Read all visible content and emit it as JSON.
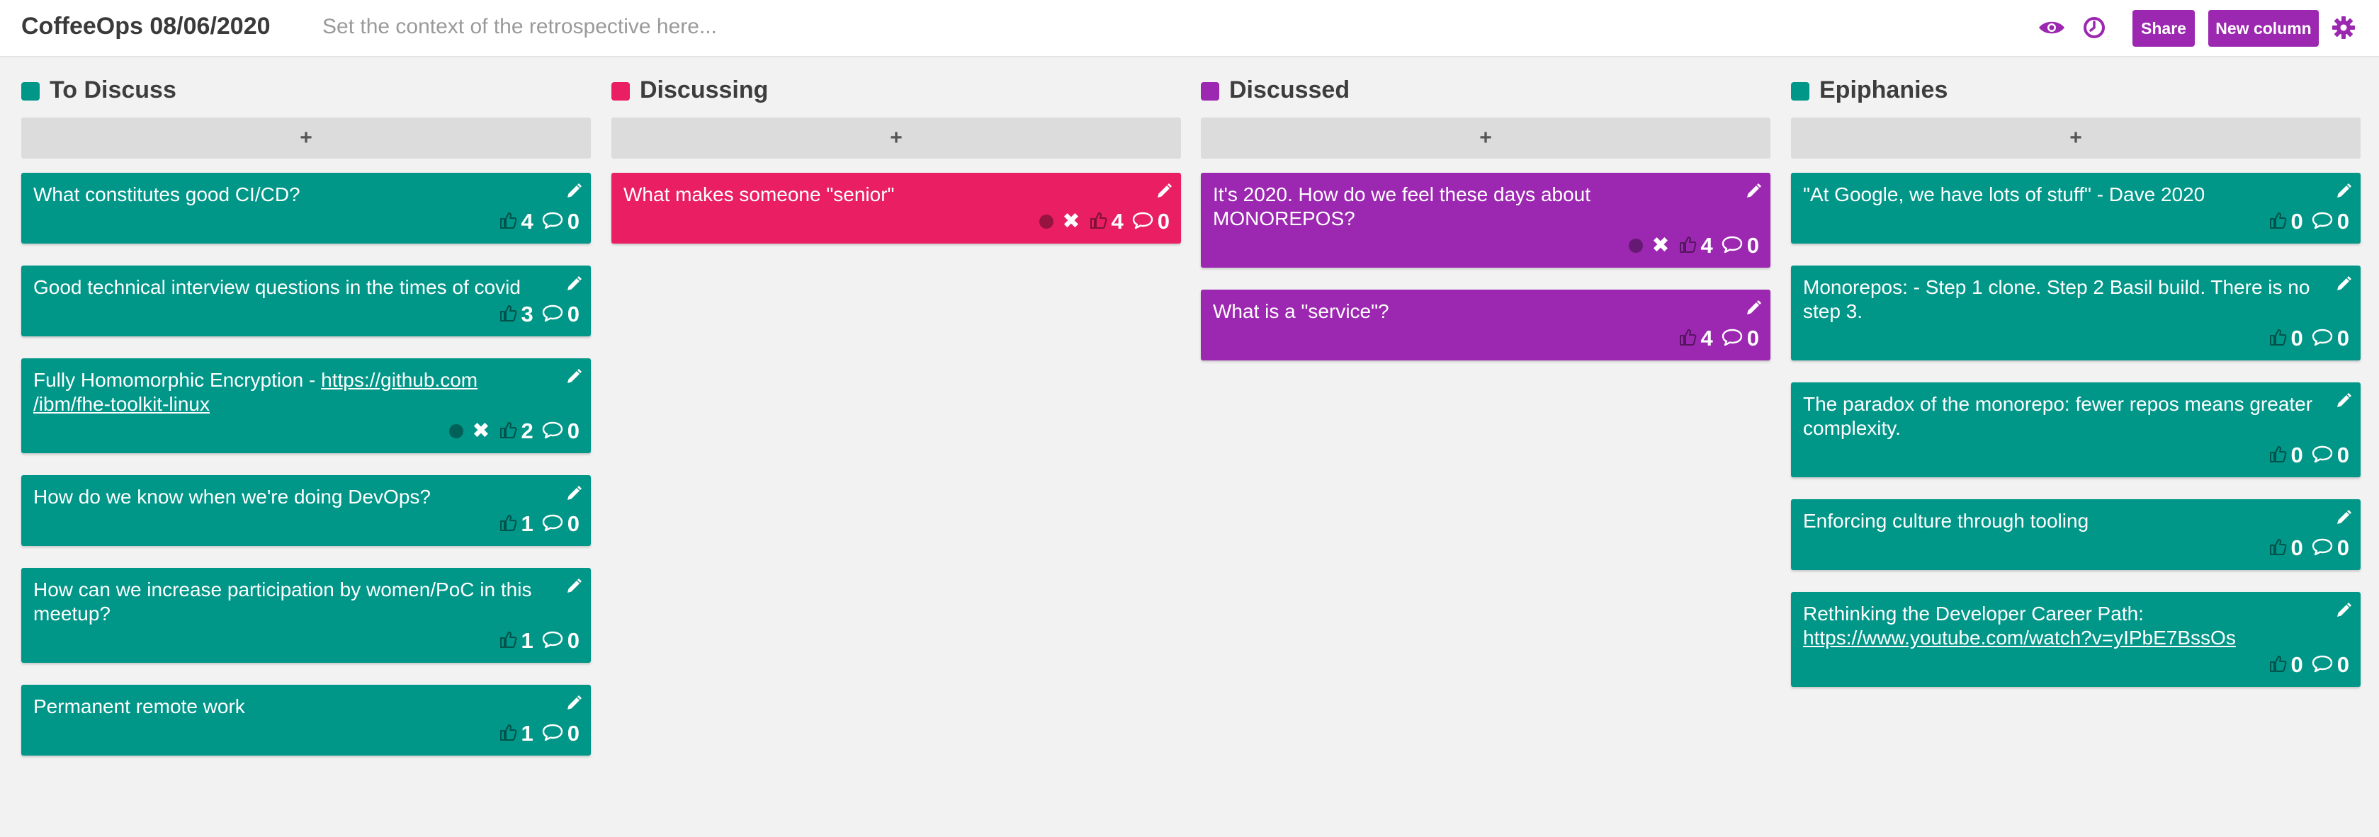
{
  "board": {
    "title": "CoffeeOps 08/06/2020",
    "context_placeholder": "Set the context of the retrospective here...",
    "share_label": "Share",
    "new_column_label": "New column",
    "accent": "#9c27b0"
  },
  "columns": [
    {
      "title": "To Discuss",
      "color": "#009688",
      "add_label": "+",
      "cards": [
        {
          "text": "What constitutes good CI/CD?",
          "likes": "4",
          "comments": "0"
        },
        {
          "text": "Good technical interview questions in the times of covid",
          "likes": "3",
          "comments": "0"
        },
        {
          "text": "Fully Homomorphic Encryption - ",
          "link": "https://github.com/ibm/fhe-toolkit-linux",
          "link_l1": "https://github.com",
          "link_l2": "/ibm/fhe-toolkit-linux",
          "likes": "2",
          "comments": "0",
          "voted": true
        },
        {
          "text": "How do we know when we're doing DevOps?",
          "likes": "1",
          "comments": "0"
        },
        {
          "text": "How can we increase participation by women/PoC in this meetup?",
          "likes": "1",
          "comments": "0"
        },
        {
          "text": "Permanent remote work",
          "likes": "1",
          "comments": "0"
        }
      ]
    },
    {
      "title": "Discussing",
      "color": "#e91e63",
      "add_label": "+",
      "cards": [
        {
          "text": "What makes someone \"senior\"",
          "likes": "4",
          "comments": "0",
          "voted": true
        }
      ]
    },
    {
      "title": "Discussed",
      "color": "#9c27b0",
      "add_label": "+",
      "cards": [
        {
          "text": "It's 2020. How do we feel these days about MONOREPOS?",
          "likes": "4",
          "comments": "0",
          "voted": true
        },
        {
          "text": "What is a \"service\"?",
          "likes": "4",
          "comments": "0"
        }
      ]
    },
    {
      "title": "Epiphanies",
      "color": "#009688",
      "add_label": "+",
      "cards": [
        {
          "text": "\"At Google, we have lots of stuff\" - Dave 2020",
          "likes": "0",
          "comments": "0"
        },
        {
          "text": "Monorepos: - Step 1 clone. Step 2 Basil build. There is no step 3.",
          "likes": "0",
          "comments": "0"
        },
        {
          "text": "The paradox of the monorepo: fewer repos means greater complexity.",
          "likes": "0",
          "comments": "0"
        },
        {
          "text": "Enforcing culture through tooling",
          "likes": "0",
          "comments": "0"
        },
        {
          "text": "Rethinking the Developer Career Path: ",
          "link": "https://www.youtube.com/watch?v=yIPbE7BssOs",
          "link_l1": "https://www.youtube.com/watch?v=yIPbE7BssOs",
          "link_l2": "",
          "likes": "0",
          "comments": "0"
        }
      ]
    }
  ]
}
